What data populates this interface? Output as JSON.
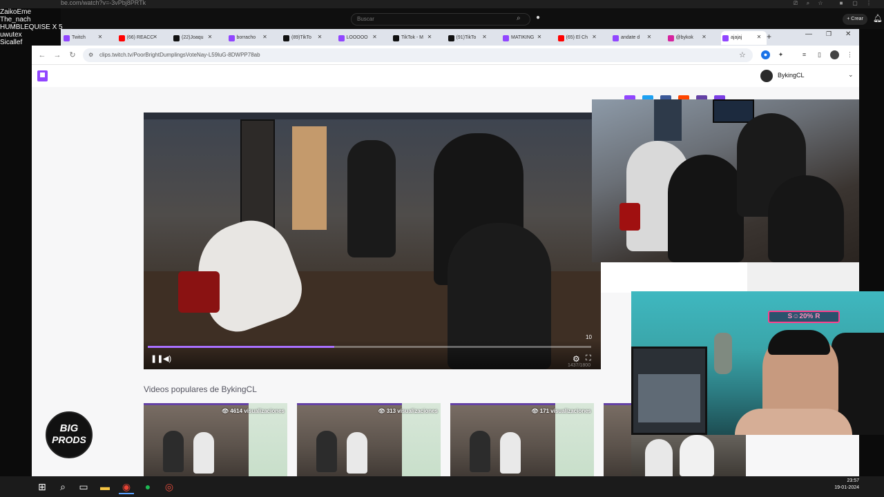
{
  "background_window": {
    "url_fragment": "be.com/watch?v=-3vPbj8PRTk",
    "search_placeholder": "Buscar",
    "create_label": "Crear"
  },
  "chat_overlay": {
    "lines": [
      "ZaikoEme",
      "The_nach",
      "HUMBLEQUISE X 5",
      "uwutex",
      "Sicallef"
    ]
  },
  "browser": {
    "tabs": [
      {
        "label": "Twitch",
        "icon_color": "#9146ff"
      },
      {
        "label": "(66) REACC",
        "icon_color": "#ff0000"
      },
      {
        "label": "(22)Joaqu",
        "icon_color": "#111111"
      },
      {
        "label": "borracho",
        "icon_color": "#9146ff"
      },
      {
        "label": "(89)TikTo",
        "icon_color": "#111111"
      },
      {
        "label": "LOOOOO",
        "icon_color": "#9146ff"
      },
      {
        "label": "TikTok - M",
        "icon_color": "#111111"
      },
      {
        "label": "(91)TikTo",
        "icon_color": "#111111"
      },
      {
        "label": "MATIKING",
        "icon_color": "#9146ff"
      },
      {
        "label": "(65) El Ch",
        "icon_color": "#ff0000"
      },
      {
        "label": "andate d",
        "icon_color": "#9146ff"
      },
      {
        "label": "@bykok",
        "icon_color": "#d6249f"
      },
      {
        "label": "ajajaj",
        "icon_color": "#9146ff"
      }
    ],
    "url": "clips.twitch.tv/PoorBrightDumplingsVoteNay-L59luG-8DWPP78ab"
  },
  "twitch": {
    "user_name": "BykingCL",
    "player": {
      "time_label": "10",
      "secondary_label": "1437/1800",
      "progress_fraction": 0.42
    },
    "popular_title": "Videos populares de BykingCL",
    "popular_videos": [
      {
        "views": "4614 visualizaciones"
      },
      {
        "views": "313 visualizaciones"
      },
      {
        "views": "171 visualizaciones"
      }
    ]
  },
  "overlay": {
    "neon_sign": "S☺20% R"
  },
  "logo": {
    "line1": "BIG",
    "line2": "PRODS"
  },
  "taskbar": {
    "time": "23:57",
    "date": "19-01-2024"
  },
  "colors": {
    "twitch_purple": "#9146ff",
    "progress": "#a970ff"
  }
}
